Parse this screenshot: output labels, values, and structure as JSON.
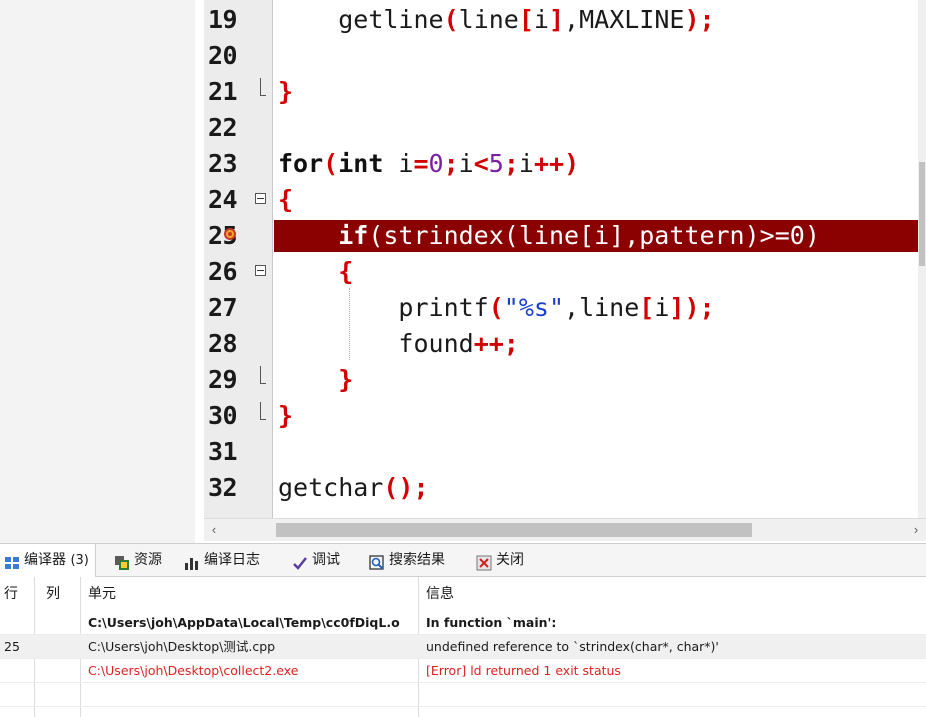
{
  "editor": {
    "lines": [
      {
        "num": "19",
        "fold": "none",
        "tokens": [
          [
            "    ",
            ""
          ],
          [
            "getline",
            "id"
          ],
          [
            "(",
            "pn"
          ],
          [
            "line",
            "id"
          ],
          [
            "[",
            "pn"
          ],
          [
            "i",
            "id"
          ],
          [
            "]",
            "pn"
          ],
          [
            ",MAXLINE",
            "id"
          ],
          [
            ");",
            "pn"
          ]
        ]
      },
      {
        "num": "20",
        "fold": "none",
        "tokens": []
      },
      {
        "num": "21",
        "fold": "end",
        "tokens": [
          [
            "}",
            "pn"
          ]
        ]
      },
      {
        "num": "22",
        "fold": "none",
        "tokens": []
      },
      {
        "num": "23",
        "fold": "none",
        "tokens": [
          [
            "for",
            "kw"
          ],
          [
            "(",
            "pn"
          ],
          [
            "int",
            "kw"
          ],
          [
            " i",
            "id"
          ],
          [
            "=",
            "pn"
          ],
          [
            "0",
            "nm"
          ],
          [
            ";",
            "pn"
          ],
          [
            "i",
            "id"
          ],
          [
            "<",
            "pn"
          ],
          [
            "5",
            "nm"
          ],
          [
            ";",
            "pn"
          ],
          [
            "i",
            "id"
          ],
          [
            "++",
            "pn"
          ],
          [
            ")",
            "pn"
          ]
        ]
      },
      {
        "num": "24",
        "fold": "start",
        "tokens": [
          [
            "{",
            "pn"
          ]
        ]
      },
      {
        "num": "25",
        "fold": "none",
        "error": true,
        "tokens": [
          [
            "    ",
            ""
          ],
          [
            "if",
            "kw"
          ],
          [
            "(strindex(line[i],pattern)>=0)",
            "id"
          ]
        ]
      },
      {
        "num": "26",
        "fold": "start",
        "tokens": [
          [
            "    ",
            ""
          ],
          [
            "{",
            "pn"
          ]
        ]
      },
      {
        "num": "27",
        "fold": "none",
        "tokens": [
          [
            "        ",
            ""
          ],
          [
            "printf",
            "id"
          ],
          [
            "(",
            "pn"
          ],
          [
            "\"%s\"",
            "st"
          ],
          [
            ",line",
            "id"
          ],
          [
            "[",
            "pn"
          ],
          [
            "i",
            "id"
          ],
          [
            "]",
            "pn"
          ],
          [
            ");",
            "pn"
          ]
        ]
      },
      {
        "num": "28",
        "fold": "none",
        "tokens": [
          [
            "        ",
            ""
          ],
          [
            "found",
            "id"
          ],
          [
            "++;",
            "pn"
          ]
        ]
      },
      {
        "num": "29",
        "fold": "end",
        "tokens": [
          [
            "    ",
            ""
          ],
          [
            "}",
            "pn"
          ]
        ]
      },
      {
        "num": "30",
        "fold": "end",
        "tokens": [
          [
            "}",
            "pn"
          ]
        ]
      },
      {
        "num": "31",
        "fold": "none",
        "tokens": []
      },
      {
        "num": "32",
        "fold": "none",
        "tokens": [
          [
            "getchar",
            "id"
          ],
          [
            "();",
            "pn"
          ]
        ]
      }
    ]
  },
  "scrollbar": {
    "left_arrow": "‹",
    "right_arrow": "›"
  },
  "tabs": [
    {
      "label": "编译器",
      "count": "(3)",
      "icon": "compiler-grid-icon",
      "active": true
    },
    {
      "label": "资源",
      "icon": "resources-icon",
      "active": false
    },
    {
      "label": "编译日志",
      "icon": "compile-log-chart-icon",
      "active": false
    },
    {
      "label": "调试",
      "icon": "debug-check-icon",
      "active": false
    },
    {
      "label": "搜索结果",
      "icon": "search-results-icon",
      "active": false
    },
    {
      "label": "关闭",
      "icon": "close-panel-icon",
      "active": false
    }
  ],
  "messages": {
    "headers": {
      "line": "行",
      "col": "列",
      "unit": "单元",
      "info": "信息"
    },
    "rows": [
      {
        "line": "",
        "col": "",
        "unit": "C:\\Users\\joh\\AppData\\Local\\Temp\\cc0fDiqL.o",
        "info": "In function `main':",
        "style": "bold"
      },
      {
        "line": "25",
        "col": "",
        "unit": "C:\\Users\\joh\\Desktop\\测试.cpp",
        "info": "undefined reference to `strindex(char*, char*)'",
        "style": "alt"
      },
      {
        "line": "",
        "col": "",
        "unit": "C:\\Users\\joh\\Desktop\\collect2.exe",
        "info": "[Error] ld returned 1 exit status",
        "style": "red"
      },
      {
        "line": "",
        "col": "",
        "unit": "",
        "info": "",
        "style": ""
      },
      {
        "line": "",
        "col": "",
        "unit": "",
        "info": "",
        "style": ""
      }
    ]
  },
  "colors": {
    "error_highlight": "#8b0000",
    "punctuation": "#d20000",
    "number": "#7a1fa2",
    "string": "#1a3fd0",
    "error_text": "#e02020"
  }
}
